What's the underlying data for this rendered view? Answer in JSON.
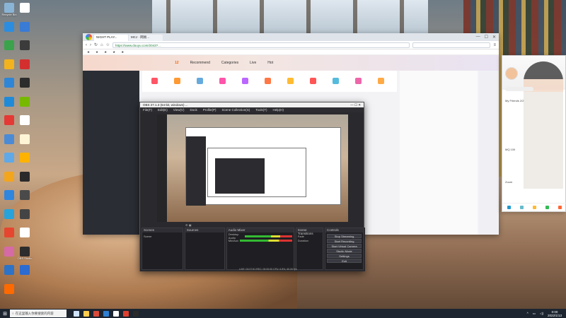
{
  "desktop": {
    "icons_left": [
      {
        "label": "Recycle Bin",
        "color": "#8ab4d6"
      },
      {
        "label": "",
        "color": "#2b8de0"
      },
      {
        "label": "",
        "color": "#3aa34b"
      },
      {
        "label": "",
        "color": "#f2b31e"
      },
      {
        "label": "",
        "color": "#2f86d6"
      },
      {
        "label": "",
        "color": "#1f8bd8"
      },
      {
        "label": "",
        "color": "#e53935"
      },
      {
        "label": "",
        "color": "#4b8bd6"
      },
      {
        "label": "",
        "color": "#5fa9e8"
      },
      {
        "label": "",
        "color": "#f3a51c"
      },
      {
        "label": "",
        "color": "#2e86de"
      },
      {
        "label": "",
        "color": "#26a3db"
      },
      {
        "label": "",
        "color": "#e6462f"
      },
      {
        "label": "",
        "color": "#d66aa6"
      },
      {
        "label": "",
        "color": "#2d73c7"
      },
      {
        "label": "",
        "color": "#ff6a00"
      }
    ],
    "icons_col2": [
      {
        "label": "",
        "color": "#ffffff"
      },
      {
        "label": "",
        "color": "#3a7bd5"
      },
      {
        "label": "",
        "color": "#3b3b3b"
      },
      {
        "label": "",
        "color": "#d32f2f"
      },
      {
        "label": "",
        "color": "#2c2c2c"
      },
      {
        "label": "",
        "color": "#76b900"
      },
      {
        "label": "",
        "color": "#ffffff"
      },
      {
        "label": "",
        "color": "#fff4d6"
      },
      {
        "label": "",
        "color": "#ffb300"
      },
      {
        "label": "",
        "color": "#2a2a2a"
      },
      {
        "label": "",
        "color": "#4a4a4a"
      },
      {
        "label": "",
        "color": "#444"
      },
      {
        "label": "",
        "color": "#ffffff"
      },
      {
        "label": "OBS Studio",
        "color": "#2d2d2d"
      },
      {
        "label": "",
        "color": "#2c6bd1"
      }
    ]
  },
  "browser": {
    "tabs": [
      {
        "label": "NIGHT PLAY..."
      },
      {
        "label": "MCJ · 网易..."
      }
    ],
    "url": "https://www.douyu.com/2043?..."
  },
  "douyu": {
    "banner_items": [
      "Recommend",
      "Categories",
      "Live",
      "Hot"
    ],
    "banner_highlight": "12",
    "sidebar": [
      "",
      "",
      "",
      "",
      "",
      "",
      "",
      "",
      "",
      "",
      "",
      "",
      "",
      "",
      "",
      "",
      ""
    ],
    "toolbar": [
      "",
      "",
      "",
      "",
      "",
      "",
      "",
      "",
      "",
      "",
      ""
    ],
    "chat": [
      "",
      "",
      "",
      "",
      "",
      "",
      "",
      "",
      "",
      "",
      "",
      "",
      "",
      "",
      "",
      "",
      "",
      "",
      ""
    ]
  },
  "obs": {
    "title": "OBS 27.1.3 (64-bit, windows) ...",
    "menu": [
      "File(F)",
      "Edit(E)",
      "View(V)",
      "Dock",
      "Profile(P)",
      "Scene Collection(S)",
      "Tools(T)",
      "Help(H)"
    ],
    "docks": [
      {
        "header": "Scenes",
        "rows": [
          "Scene"
        ]
      },
      {
        "header": "Sources",
        "rows": [
          "",
          "",
          "",
          "",
          ""
        ]
      },
      {
        "header": "Audio Mixer",
        "rows": [
          "Desktop Audio",
          "Mic/Aux"
        ]
      },
      {
        "header": "Scene Transitions",
        "rows": [
          "Fade",
          "Duration"
        ]
      },
      {
        "header": "Controls",
        "buttons": [
          "Stop Streaming",
          "Start Recording",
          "Start Virtual Camera",
          "Studio Mode",
          "Settings",
          "Exit"
        ]
      }
    ],
    "status": "LIVE: 00:27:51   REC: 00:00:00   CPU: 6.8%, 60.00 fps"
  },
  "qq": {
    "search_placeholder": "",
    "items": [
      "My Friends 2/2",
      "",
      "",
      "",
      "",
      "",
      "MQ 100",
      "",
      "",
      "",
      "Zoom"
    ]
  },
  "taskbar": {
    "search_placeholder": "在这里输入你要搜索的内容",
    "apps": [
      "#cfe3ff",
      "#ffcc4d",
      "#d94a3a",
      "#2f7fd3",
      "#ffffff",
      "#e04030",
      "#2a2a2a"
    ],
    "time": "0:00",
    "date": "2022/1/13"
  }
}
